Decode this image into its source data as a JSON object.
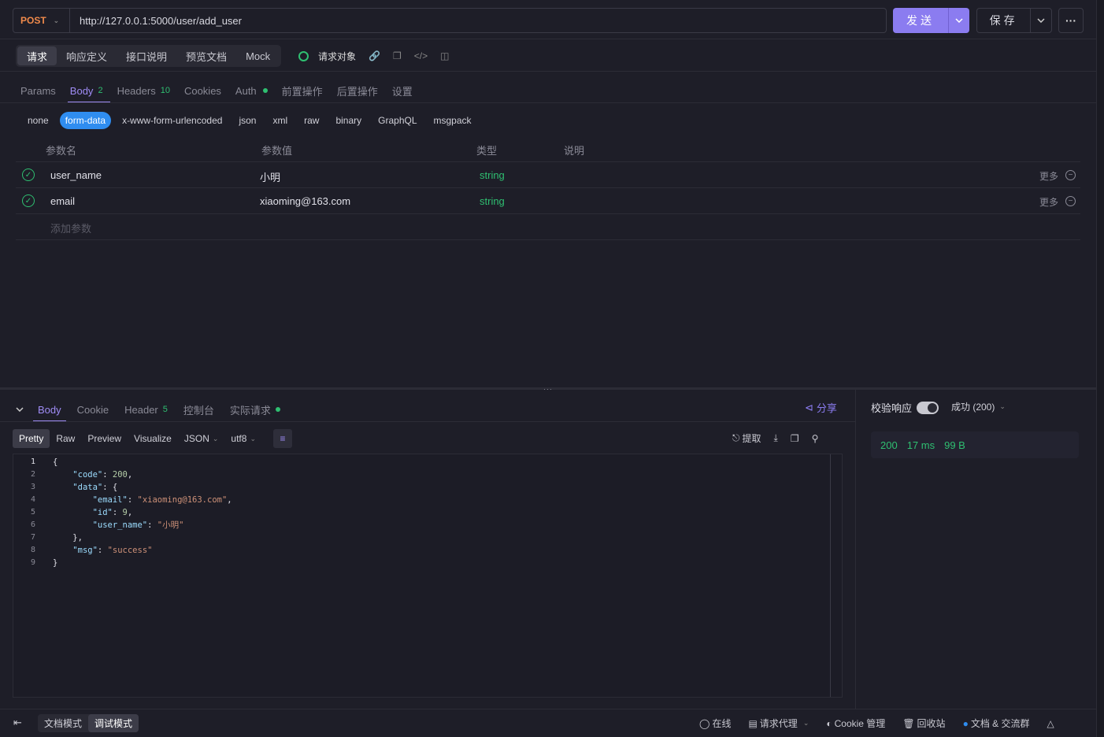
{
  "request": {
    "method": "POST",
    "url": "http://127.0.0.1:5000/user/add_user",
    "send_label": "发送",
    "save_label": "保存"
  },
  "mode_tabs": [
    "请求",
    "响应定义",
    "接口说明",
    "预览文档",
    "Mock"
  ],
  "request_object_label": "请求对象",
  "sub_tabs": {
    "params": "Params",
    "body": "Body",
    "body_count": "2",
    "headers": "Headers",
    "headers_count": "10",
    "cookies": "Cookies",
    "auth": "Auth",
    "pre": "前置操作",
    "post": "后置操作",
    "settings": "设置"
  },
  "body_types": [
    "none",
    "form-data",
    "x-www-form-urlencoded",
    "json",
    "xml",
    "raw",
    "binary",
    "GraphQL",
    "msgpack"
  ],
  "params_table": {
    "headers": [
      "参数名",
      "参数值",
      "类型",
      "说明"
    ],
    "rows": [
      {
        "name": "user_name",
        "value": "小明",
        "type": "string",
        "more": "更多"
      },
      {
        "name": "email",
        "value": "xiaoming@163.com",
        "type": "string",
        "more": "更多"
      }
    ],
    "add_placeholder": "添加参数"
  },
  "response": {
    "tabs": {
      "body": "Body",
      "cookie": "Cookie",
      "header": "Header",
      "header_count": "5",
      "console": "控制台",
      "actual": "实际请求"
    },
    "share": "分享",
    "formats": [
      "Pretty",
      "Raw",
      "Preview",
      "Visualize"
    ],
    "lang": "JSON",
    "encoding": "utf8",
    "extract": "提取",
    "code_lines": [
      [
        [
          "p",
          "{"
        ]
      ],
      [
        [
          "p",
          "    "
        ],
        [
          "k",
          "\"code\""
        ],
        [
          "p",
          ": "
        ],
        [
          "n",
          "200"
        ],
        [
          "p",
          ","
        ]
      ],
      [
        [
          "p",
          "    "
        ],
        [
          "k",
          "\"data\""
        ],
        [
          "p",
          ": {"
        ]
      ],
      [
        [
          "p",
          "        "
        ],
        [
          "k",
          "\"email\""
        ],
        [
          "p",
          ": "
        ],
        [
          "s",
          "\"xiaoming@163.com\""
        ],
        [
          "p",
          ","
        ]
      ],
      [
        [
          "p",
          "        "
        ],
        [
          "k",
          "\"id\""
        ],
        [
          "p",
          ": "
        ],
        [
          "n",
          "9"
        ],
        [
          "p",
          ","
        ]
      ],
      [
        [
          "p",
          "        "
        ],
        [
          "k",
          "\"user_name\""
        ],
        [
          "p",
          ": "
        ],
        [
          "s",
          "\"小明\""
        ]
      ],
      [
        [
          "p",
          "    },"
        ]
      ],
      [
        [
          "p",
          "    "
        ],
        [
          "k",
          "\"msg\""
        ],
        [
          "p",
          ": "
        ],
        [
          "s",
          "\"success\""
        ]
      ],
      [
        [
          "p",
          "}"
        ]
      ]
    ],
    "line_numbers": [
      "1",
      "2",
      "3",
      "4",
      "5",
      "6",
      "7",
      "8",
      "9"
    ],
    "validate_label": "校验响应",
    "success_label": "成功 (200)",
    "status": "200",
    "time": "17 ms",
    "size": "99 B"
  },
  "footer": {
    "doc_mode": "文档模式",
    "debug_mode": "调试模式",
    "online": "在线",
    "proxy": "请求代理",
    "cookie_mgmt": "Cookie 管理",
    "recycle": "回收站",
    "docs_group": "文档 & 交流群"
  }
}
